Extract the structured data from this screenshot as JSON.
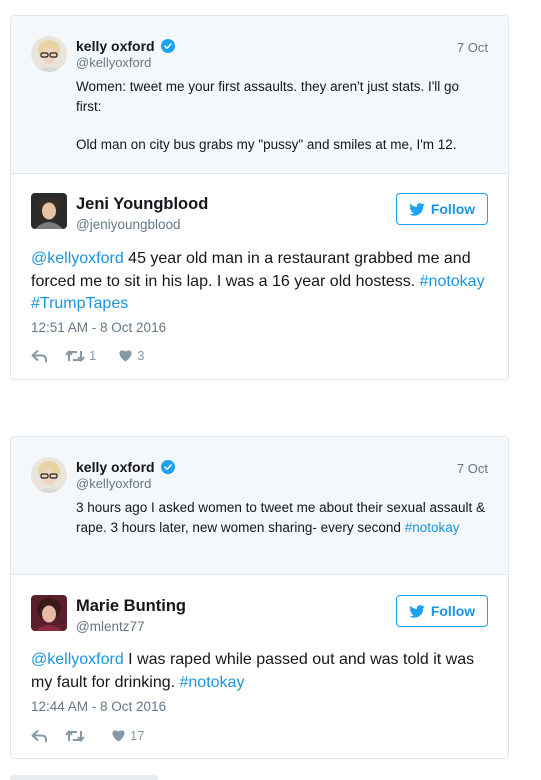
{
  "embeds": [
    {
      "quoted": {
        "name": "kelly oxford",
        "handle": "@kellyoxford",
        "date": "7 Oct",
        "text_line1": "Women: tweet me your first assaults. they aren't just stats. I'll go first:",
        "text_line2": "Old man on city bus grabs my \"pussy\" and smiles at me, I'm 12."
      },
      "tweet": {
        "name": "Jeni Youngblood",
        "handle": "@jeniyoungblood",
        "follow_label": "Follow",
        "mention": "@kellyoxford",
        "body": " 45 year old man in a restaurant grabbed me and forced me to sit in his lap. I was a 16 year old hostess. ",
        "hashtag1": "#notokay",
        "hashtag2": "#TrumpTapes",
        "timestamp": "12:51 AM - 8 Oct 2016",
        "retweets": "1",
        "likes": "3"
      }
    },
    {
      "quoted": {
        "name": "kelly oxford",
        "handle": "@kellyoxford",
        "date": "7 Oct",
        "text": "3 hours ago I asked women to tweet me about their sexual assault & rape. 3 hours later, new women sharing- every second ",
        "hashtag": "#notokay"
      },
      "tweet": {
        "name": "Marie Bunting",
        "handle": "@mlentz77",
        "follow_label": "Follow",
        "mention": "@kellyoxford",
        "body": " I was raped while passed out and was told it was my fault for drinking. ",
        "hashtag1": "#notokay",
        "timestamp": "12:44 AM - 8 Oct 2016",
        "retweets": "",
        "likes": "17"
      }
    }
  ],
  "icons": {
    "verified": "verified-badge-icon",
    "follow": "twitter-bird-icon",
    "reply": "reply-icon",
    "retweet": "retweet-icon",
    "like": "heart-icon"
  },
  "colors": {
    "link": "#1b95e0",
    "muted": "#657786",
    "border": "#e1e8ed",
    "quoted_bg": "#f5f8fa"
  }
}
